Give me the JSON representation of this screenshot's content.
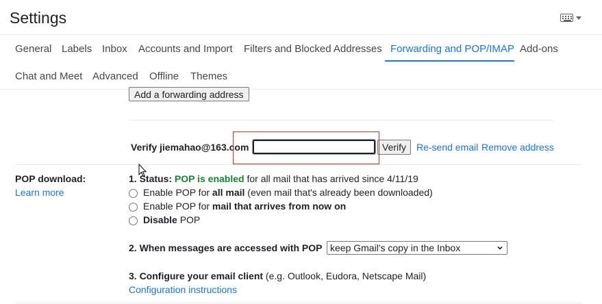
{
  "header": {
    "title": "Settings",
    "input_tools": "keyboard-icon"
  },
  "tabs": {
    "row1": [
      "General",
      "Labels",
      "Inbox",
      "Accounts and Import",
      "Filters and Blocked Addresses",
      "Forwarding and POP/IMAP",
      "Add-ons"
    ],
    "row2": [
      "Chat and Meet",
      "Advanced",
      "Offline",
      "Themes"
    ],
    "active": "Forwarding and POP/IMAP"
  },
  "forwarding": {
    "add_button": "Add a forwarding address",
    "verify_label": "Verify jiemahao@163.com",
    "verify_input_value": "",
    "verify_button": "Verify",
    "resend_link": "Re-send email",
    "remove_link": "Remove address"
  },
  "pop": {
    "label": "POP download:",
    "learn_more": "Learn more",
    "status_prefix": "1. Status: ",
    "status_value": "POP is enabled",
    "status_suffix": " for all mail that has arrived since 4/11/19",
    "options": [
      {
        "pre": "Enable POP for ",
        "bold": "all mail",
        "post": " (even mail that's already been downloaded)"
      },
      {
        "pre": "Enable POP for ",
        "bold": "mail that arrives from now on",
        "post": ""
      },
      {
        "pre": "",
        "bold": "Disable",
        "post": " POP"
      }
    ],
    "access_label": "2. When messages are accessed with POP",
    "access_selected": "keep Gmail's copy in the Inbox",
    "configure_label": "3. Configure your email client",
    "configure_examples": " (e.g. Outlook, Eudora, Netscape Mail)",
    "config_link": "Configuration instructions"
  },
  "colors": {
    "accent": "#1a73e8",
    "status_green": "#188038",
    "highlight_red": "#d93025"
  }
}
